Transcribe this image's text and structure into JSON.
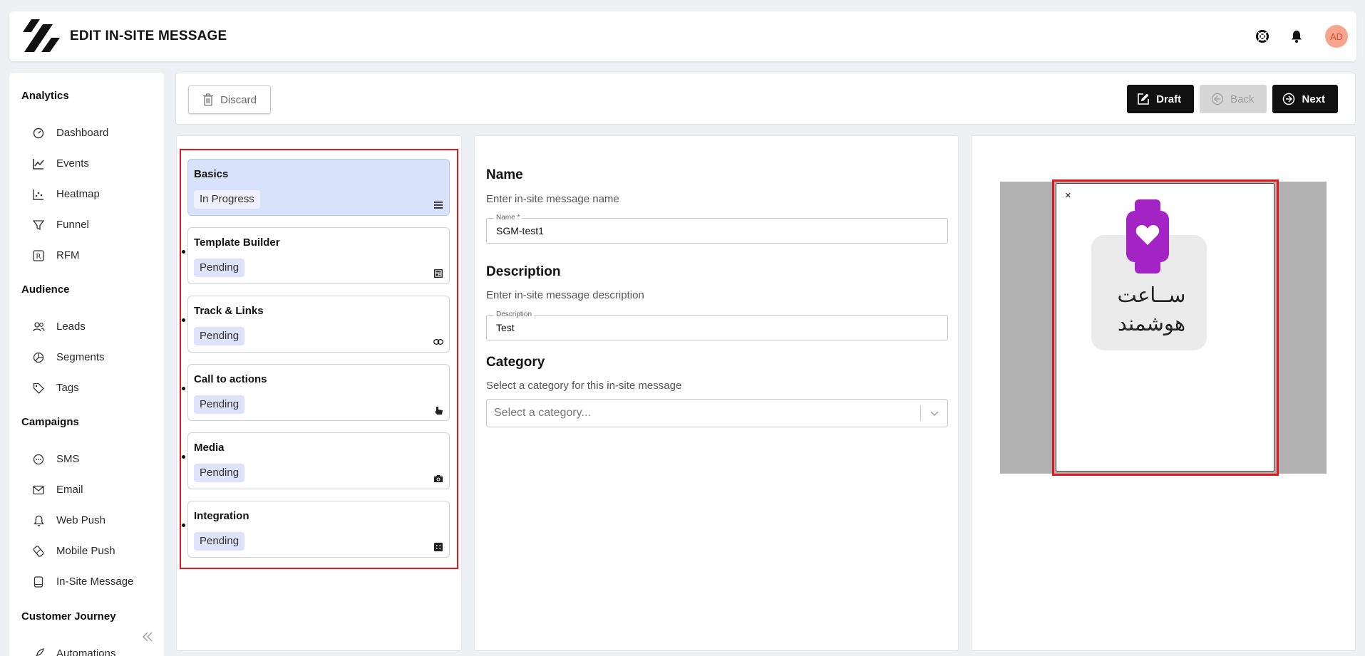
{
  "header": {
    "title": "EDIT IN-SITE MESSAGE",
    "avatar_initials": "AD"
  },
  "sidebar": {
    "sections": [
      {
        "title": "Analytics",
        "items": [
          {
            "label": "Dashboard",
            "icon": "gauge-icon"
          },
          {
            "label": "Events",
            "icon": "line-chart-icon"
          },
          {
            "label": "Heatmap",
            "icon": "scatter-chart-icon"
          },
          {
            "label": "Funnel",
            "icon": "funnel-icon"
          },
          {
            "label": "RFM",
            "icon": "rfm-icon"
          }
        ]
      },
      {
        "title": "Audience",
        "items": [
          {
            "label": "Leads",
            "icon": "users-icon"
          },
          {
            "label": "Segments",
            "icon": "pie-chart-icon"
          },
          {
            "label": "Tags",
            "icon": "tag-icon"
          }
        ]
      },
      {
        "title": "Campaigns",
        "items": [
          {
            "label": "SMS",
            "icon": "chat-bubble-icon"
          },
          {
            "label": "Email",
            "icon": "envelope-icon"
          },
          {
            "label": "Web Push",
            "icon": "bell-icon"
          },
          {
            "label": "Mobile Push",
            "icon": "mobile-push-icon"
          },
          {
            "label": "In-Site Message",
            "icon": "in-site-message-icon"
          }
        ]
      },
      {
        "title": "Customer Journey",
        "items": [
          {
            "label": "Automations",
            "icon": "rocket-icon"
          }
        ]
      }
    ]
  },
  "toolbar": {
    "discard_label": "Discard",
    "draft_label": "Draft",
    "back_label": "Back",
    "next_label": "Next"
  },
  "steps": [
    {
      "title": "Basics",
      "status": "In Progress",
      "icon": "list-icon",
      "active": true
    },
    {
      "title": "Template Builder",
      "status": "Pending",
      "icon": "template-icon",
      "active": false
    },
    {
      "title": "Track & Links",
      "status": "Pending",
      "icon": "link-icon",
      "active": false
    },
    {
      "title": "Call to actions",
      "status": "Pending",
      "icon": "pointer-icon",
      "active": false
    },
    {
      "title": "Media",
      "status": "Pending",
      "icon": "camera-icon",
      "active": false
    },
    {
      "title": "Integration",
      "status": "Pending",
      "icon": "integration-icon",
      "active": false
    }
  ],
  "form": {
    "name_heading": "Name",
    "name_hint": "Enter in-site message name",
    "name_label": "Name *",
    "name_value": "SGM-test1",
    "description_heading": "Description",
    "description_hint": "Enter in-site message description",
    "description_label": "Description",
    "description_value": "Test",
    "category_heading": "Category",
    "category_hint": "Select a category for this in-site message",
    "category_placeholder": "Select a category..."
  },
  "preview": {
    "close_symbol": "×",
    "image_text_line1": "ســاعت",
    "image_text_line2": "هوشمند",
    "watch_color": "#a323c4"
  },
  "colors": {
    "highlight_outline": "#e0191b",
    "active_step_bg": "#d8e3fb",
    "dark_button": "#111111"
  }
}
